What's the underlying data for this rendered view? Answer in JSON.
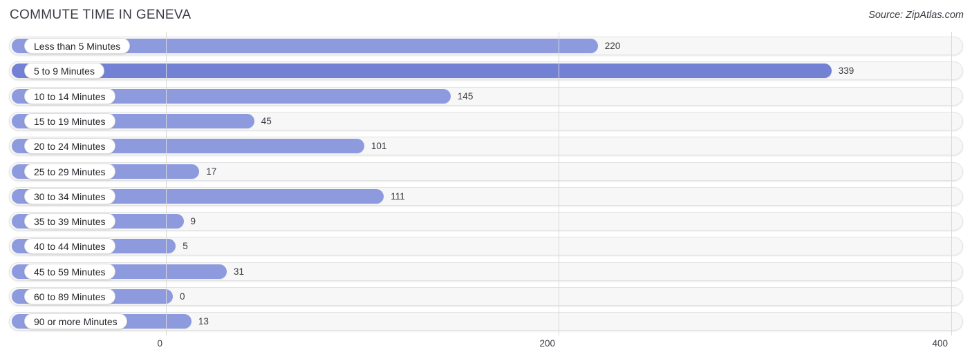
{
  "header": {
    "title": "COMMUTE TIME IN GENEVA",
    "source": "Source: ZipAtlas.com"
  },
  "colors": {
    "bar": "#8d9ade",
    "bar_highlight": "#7281d4",
    "track": "#f7f7f7",
    "gridline": "#d9d9dd",
    "text": "#3a3a44"
  },
  "chart_data": {
    "type": "bar",
    "orientation": "horizontal",
    "title": "COMMUTE TIME IN GENEVA",
    "xlabel": "",
    "ylabel": "",
    "xlim": [
      0,
      400
    ],
    "xticks": [
      0,
      200,
      400
    ],
    "xtick_labels": [
      "0",
      "200",
      "400"
    ],
    "grid": true,
    "legend": false,
    "categories": [
      "Less than 5 Minutes",
      "5 to 9 Minutes",
      "10 to 14 Minutes",
      "15 to 19 Minutes",
      "20 to 24 Minutes",
      "25 to 29 Minutes",
      "30 to 34 Minutes",
      "35 to 39 Minutes",
      "40 to 44 Minutes",
      "45 to 59 Minutes",
      "60 to 89 Minutes",
      "90 or more Minutes"
    ],
    "values": [
      220,
      339,
      145,
      45,
      101,
      17,
      111,
      9,
      5,
      31,
      0,
      13
    ],
    "value_labels": [
      "220",
      "339",
      "145",
      "45",
      "101",
      "17",
      "111",
      "9",
      "5",
      "31",
      "0",
      "13"
    ]
  }
}
